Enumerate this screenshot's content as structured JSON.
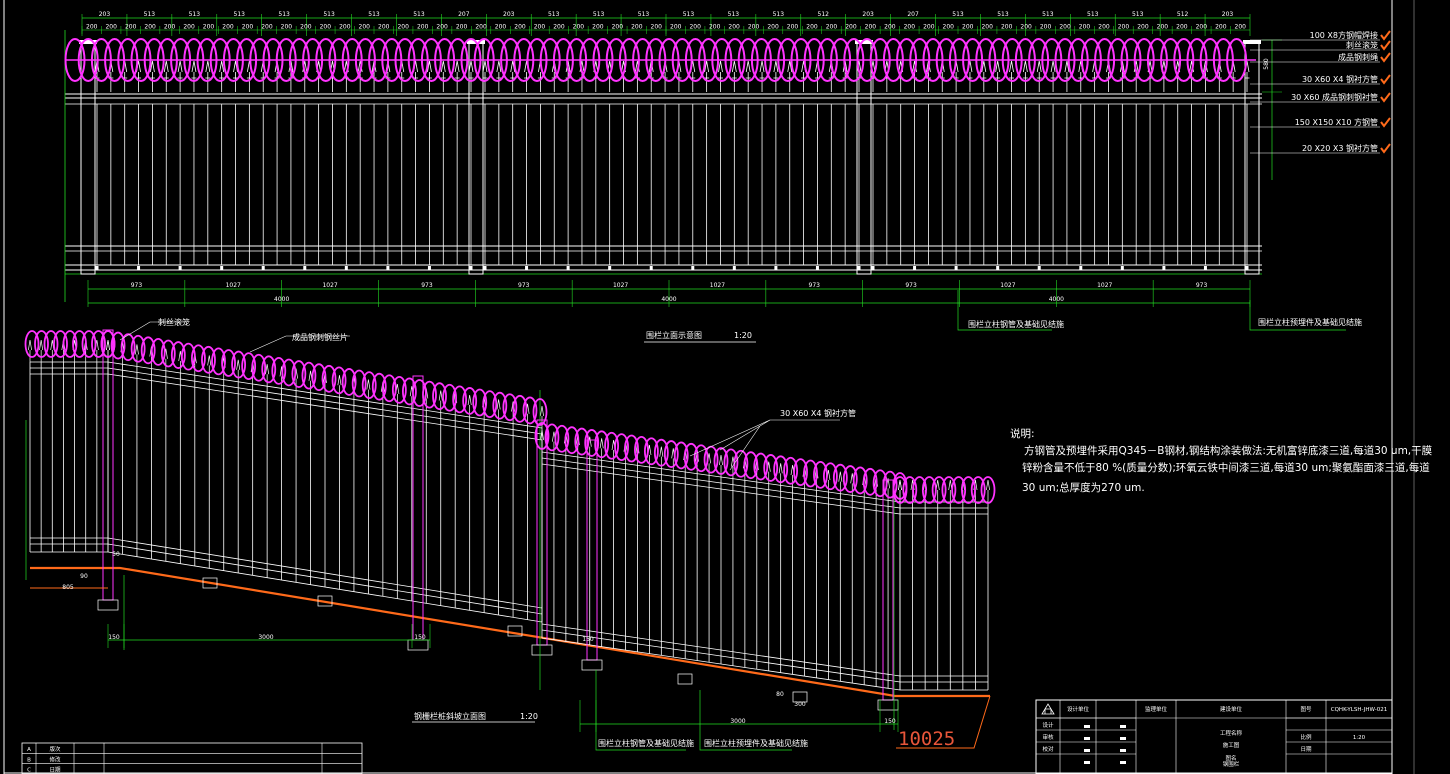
{
  "colors": {
    "background": "#000000",
    "fence": "#ffffff",
    "razor_wire": "#ff33ff",
    "dimension": "#22dd22",
    "ground": "#ff6a1a",
    "frame": "#ffffff",
    "check": "#ff6a1a"
  },
  "elevation": {
    "top_dims": [
      "203",
      "513",
      "513",
      "513",
      "513",
      "513",
      "513",
      "513",
      "207",
      "203",
      "513",
      "513",
      "513",
      "513",
      "513",
      "513",
      "512",
      "203",
      "207",
      "513",
      "513",
      "513",
      "513",
      "513",
      "512",
      "203"
    ],
    "sub_dims": [
      "200",
      "200",
      "200",
      "200",
      "200",
      "200",
      "200",
      "200",
      "200",
      "200",
      "200",
      "200",
      "200",
      "200",
      "200",
      "200",
      "200",
      "200",
      "200",
      "200",
      "200",
      "200",
      "200",
      "200",
      "200",
      "200",
      "200",
      "200",
      "200",
      "200",
      "200",
      "200",
      "200",
      "200",
      "200",
      "200",
      "200",
      "200",
      "200",
      "200",
      "200",
      "200",
      "200",
      "200",
      "200",
      "200",
      "200",
      "200",
      "200",
      "200",
      "200",
      "200",
      "200",
      "200",
      "200",
      "200",
      "200",
      "200",
      "200",
      "200"
    ],
    "bottom_dims": [
      "973",
      "1027",
      "1027",
      "973",
      "973",
      "1027",
      "1027",
      "973",
      "973",
      "1027",
      "1027",
      "973"
    ],
    "total_dims": [
      "4000",
      "4000",
      "4000"
    ],
    "title": "围栏立面示意图",
    "scale": "1:20",
    "note_post_left": "围栏立柱钢管及基础见结施",
    "note_post_right": "围栏立柱预埋件及基础见结施",
    "callouts": [
      "100 X8方钢帽焊接",
      "刺丝滚笼",
      "成品钢刺绳",
      "30 X60 X4 钢衬方管",
      "30 X60 成品钢刺钢衬管",
      "150 X150 X10 方钢管",
      "20 X20 X3 钢衬方管"
    ],
    "side_dim": "580"
  },
  "slope": {
    "label_wire": "刺丝滚笼",
    "label_barb": "成品钢刺钢丝片",
    "label_tube": "30 X60 X4 钢衬方管",
    "dims": [
      "805",
      "150",
      "3000",
      "150",
      "150",
      "3000",
      "150"
    ],
    "small_dims": [
      "50",
      "90",
      "80",
      "300"
    ],
    "title": "钢栅栏桩斜坡立面图",
    "scale": "1:20",
    "note_post_left": "围栏立柱钢管及基础见结施",
    "note_post_right": "围栏立柱预埋件及基础见结施",
    "big_number": "10025"
  },
  "notes": {
    "title": "说明:",
    "lines": [
      "方钢管及预埋件采用Q345－B钢材,钢结构涂装做法:无机富锌底漆三道,每道30 um,干膜",
      "锌粉含量不低于80 %(质量分数);环氧云铁中间漆三道,每道30 um;聚氨酯面漆三道,每道",
      "30 um;总厚度为270 um."
    ]
  },
  "title_block": {
    "cells": [
      "设计单位",
      "监理单位",
      "建设单位",
      "工程名称",
      "图号",
      "CQHK-YLSH-JHW-021",
      "设计",
      "审核",
      "校对",
      "施工图",
      "比例",
      "1:20",
      "日期",
      "图名",
      "钢围栏"
    ],
    "logo": "logo-icon"
  },
  "revision_table": {
    "rows": [
      [
        "A",
        "版次"
      ],
      [
        "B",
        "修改"
      ],
      [
        "C",
        "日期"
      ]
    ]
  }
}
